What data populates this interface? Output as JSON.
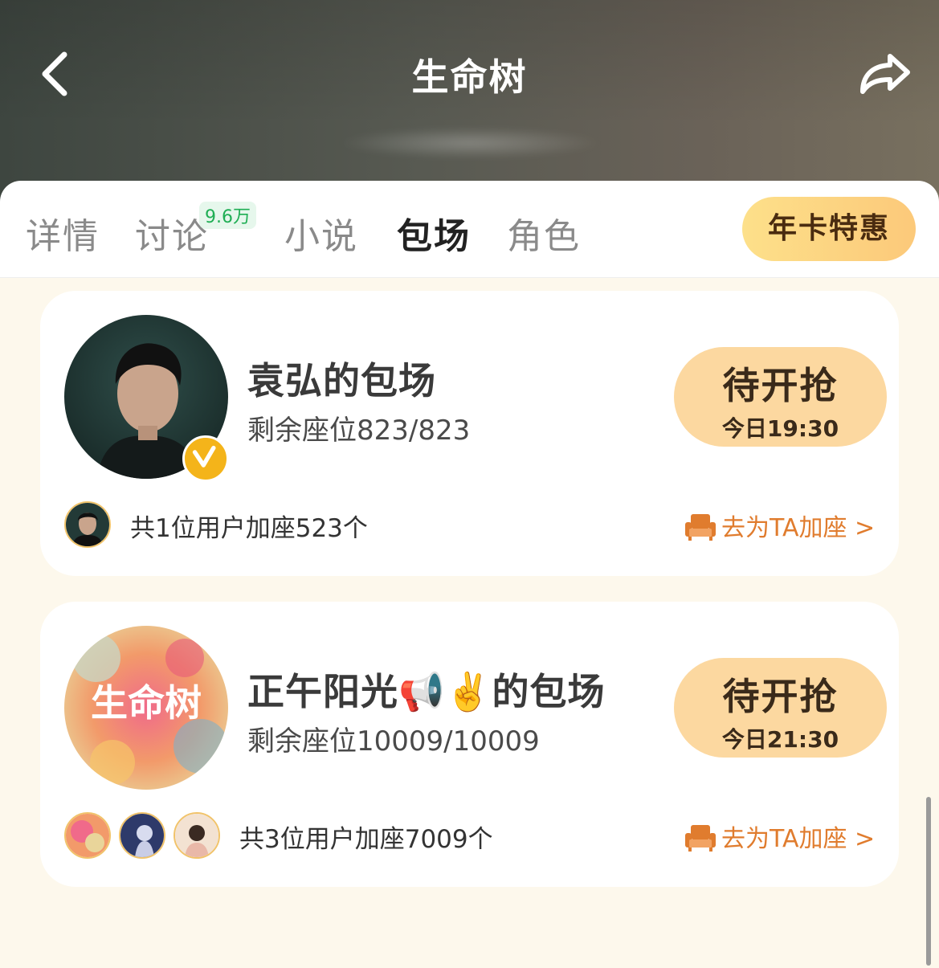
{
  "header": {
    "title": "生命树"
  },
  "tabs": [
    {
      "label": "详情",
      "active": false
    },
    {
      "label": "讨论",
      "active": false,
      "badge": "9.6万"
    },
    {
      "label": "小说",
      "active": false
    },
    {
      "label": "包场",
      "active": true
    },
    {
      "label": "角色",
      "active": false
    }
  ],
  "promo": {
    "label": "年卡特惠"
  },
  "cards": [
    {
      "title": "袁弘的包场",
      "seats": "剩余座位823/823",
      "status": "待开抢",
      "time": "今日19:30",
      "join_text": "共1位用户加座523个",
      "add_seat": "去为TA加座 >",
      "verified": true
    },
    {
      "title": "正午阳光📢✌️的包场",
      "seats": "剩余座位10009/10009",
      "status": "待开抢",
      "time": "今日21:30",
      "join_text": "共3位用户加座7009个",
      "add_seat": "去为TA加座 >",
      "avatar_text": "生命树"
    }
  ],
  "colors": {
    "accent_orange": "#e07c2e",
    "status_bg": "#fcd8a0",
    "badge_green": "#1fae54",
    "page_bg": "#fdf8ec"
  },
  "icons": {
    "back": "chevron-left-icon",
    "share": "share-arrow-icon",
    "verified": "verified-v-icon",
    "sofa": "sofa-icon"
  }
}
